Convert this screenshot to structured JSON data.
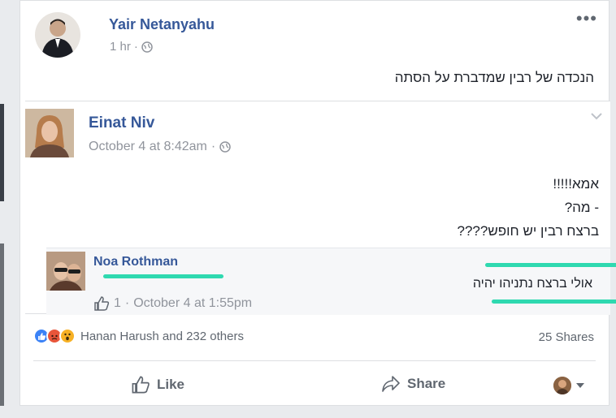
{
  "post": {
    "author": "Yair Netanyahu",
    "time": "1 hr",
    "separator": "·",
    "text": "הנכדה של רבין שמדברת על הסתה",
    "more_icon": "more-dots-icon"
  },
  "shared": {
    "author": "Einat Niv",
    "time": "October 4 at 8:42am",
    "separator": "·",
    "lines": [
      "אמא!!!!!",
      "- מה?",
      "ברצח רבין יש חופש????"
    ]
  },
  "reply": {
    "author": "Noa Rothman",
    "text": "אולי ברצח נתניהו יהיה",
    "likes": "1",
    "separator": "·",
    "time": "October 4 at 1:55pm"
  },
  "stats": {
    "reactions_text": "Hanan Harush and 232 others",
    "shares": "25 Shares",
    "reaction_colors": {
      "like": "#3b82f6",
      "angry": "#e8553a",
      "wow": "#f7b125"
    }
  },
  "actions": {
    "like": "Like",
    "share": "Share"
  },
  "highlight_color": "#2fd9b0"
}
